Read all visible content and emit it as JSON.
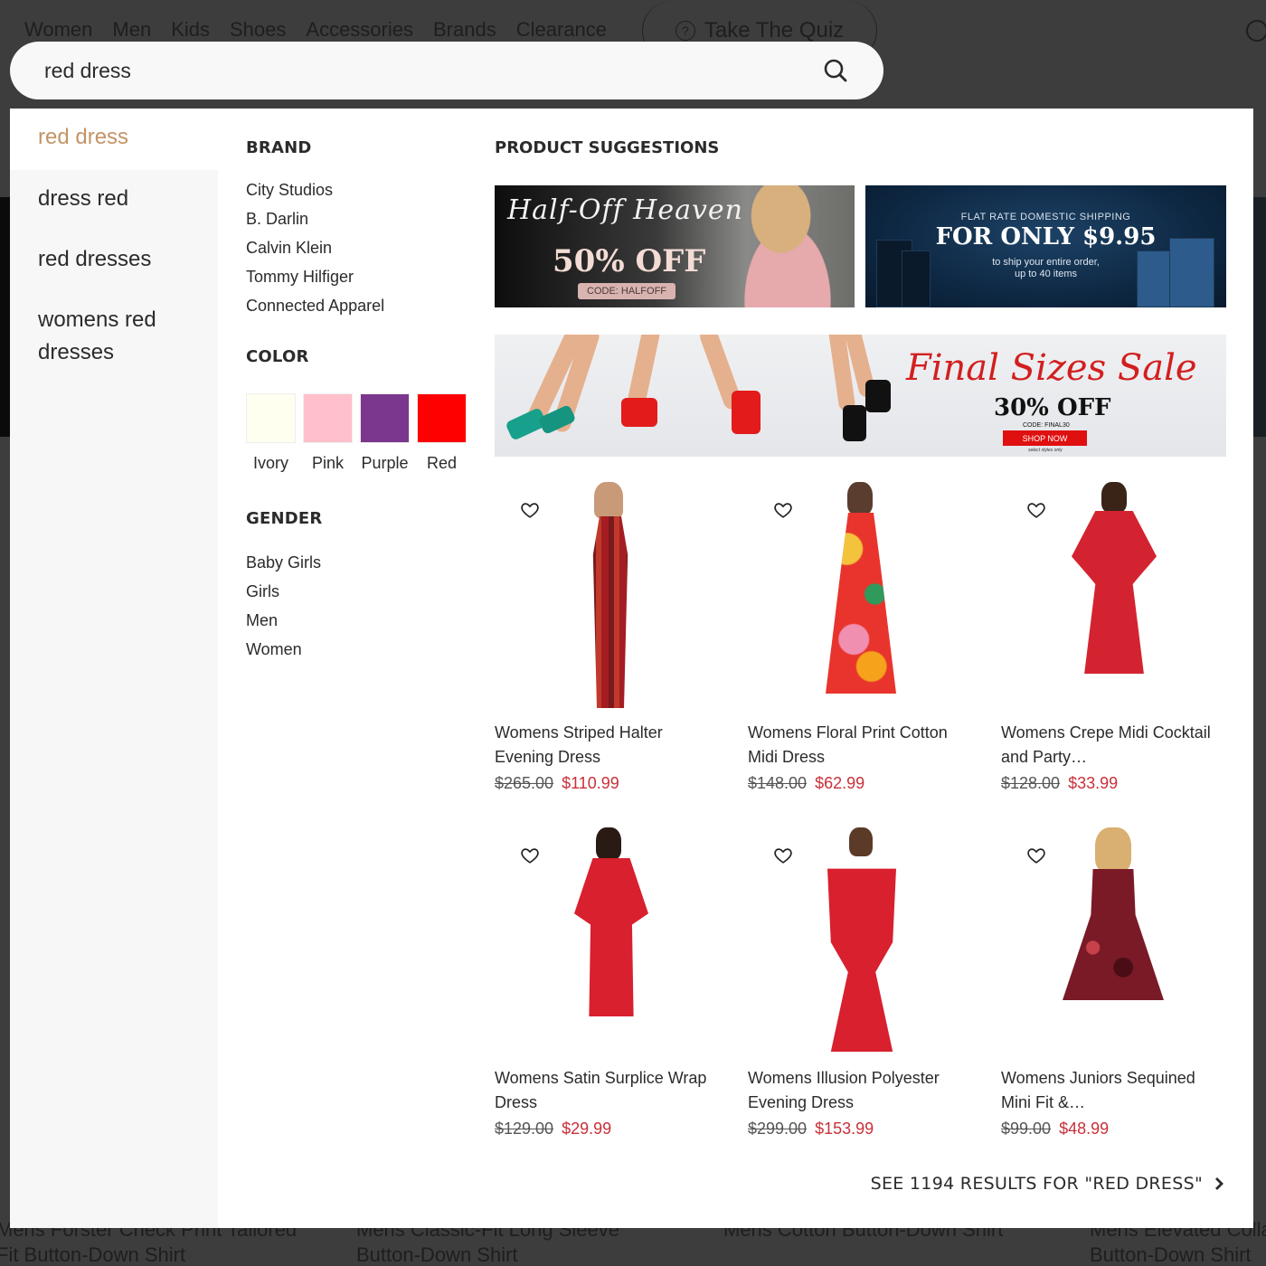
{
  "nav": {
    "items": [
      "Women",
      "Men",
      "Kids",
      "Shoes",
      "Accessories",
      "Brands",
      "Clearance"
    ],
    "quiz_label": "Take The Quiz"
  },
  "search": {
    "value": "red dress",
    "placeholder": "",
    "icon": "search-icon"
  },
  "suggestions": [
    {
      "label": "red dress",
      "active": true
    },
    {
      "label": "dress red",
      "active": false
    },
    {
      "label": "red dresses",
      "active": false
    },
    {
      "label": "womens red dresses",
      "active": false
    }
  ],
  "facets": {
    "brand": {
      "heading": "BRAND",
      "items": [
        "City Studios",
        "B. Darlin",
        "Calvin Klein",
        "Tommy Hilfiger",
        "Connected Apparel"
      ]
    },
    "color": {
      "heading": "COLOR",
      "items": [
        {
          "label": "Ivory",
          "hex": "#fffff0"
        },
        {
          "label": "Pink",
          "hex": "#ffc0cb"
        },
        {
          "label": "Purple",
          "hex": "#7b378d"
        },
        {
          "label": "Red",
          "hex": "#ff0000"
        }
      ]
    },
    "gender": {
      "heading": "GENDER",
      "items": [
        "Baby Girls",
        "Girls",
        "Men",
        "Women"
      ]
    }
  },
  "product_suggestions": {
    "heading": "PRODUCT SUGGESTIONS",
    "banners": [
      {
        "script": "Half-Off Heaven",
        "headline": "50% OFF",
        "code": "CODE: HALFOFF"
      },
      {
        "small": "FLAT RATE DOMESTIC SHIPPING",
        "headline": "FOR ONLY $9.95",
        "sub1": "to ship your entire order,",
        "sub2": "up to 40 items"
      },
      {
        "script": "Final Sizes Sale",
        "headline": "30% OFF",
        "code": "CODE: FINAL30",
        "cta": "SHOP NOW",
        "note": "select styles only"
      }
    ],
    "products": [
      {
        "title": "Womens Striped Halter Evening Dress",
        "price_old": "$265.00",
        "price_new": "$110.99"
      },
      {
        "title": "Womens Floral Print Cotton Midi Dress",
        "price_old": "$148.00",
        "price_new": "$62.99"
      },
      {
        "title": "Womens Crepe Midi Cocktail and Party…",
        "price_old": "$128.00",
        "price_new": "$33.99"
      },
      {
        "title": "Womens Satin Surplice Wrap Dress",
        "price_old": "$129.00",
        "price_new": "$29.99"
      },
      {
        "title": "Womens Illusion Polyester Evening Dress",
        "price_old": "$299.00",
        "price_new": "$153.99"
      },
      {
        "title": "Womens Juniors Sequined Mini Fit &…",
        "price_old": "$99.00",
        "price_new": "$48.99"
      }
    ]
  },
  "see_all": {
    "label": "SEE 1194 RESULTS FOR \"RED DRESS\""
  },
  "background": {
    "products": [
      "Mens Forster Check Print Tailored Fit Button-Down Shirt",
      "Mens Classic-Fit Long Sleeve Button-Down Shirt",
      "Mens Cotton Button-Down Shirt",
      "Mens Elevated Collar Button-Down Shirt"
    ]
  },
  "colors": {
    "accent_suggestion": "#c39466",
    "sale_price": "#c8303a"
  }
}
